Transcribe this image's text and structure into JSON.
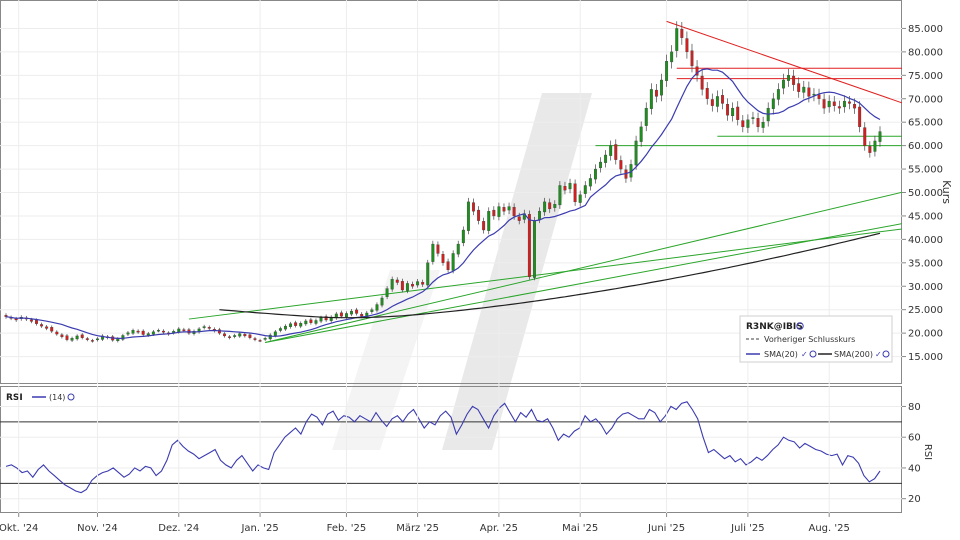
{
  "chart_data": [
    {
      "type": "line",
      "panel": "price",
      "symbol": "R3NK@IBIS",
      "ylabel": "Kurs",
      "ylim": [
        10000,
        90000
      ],
      "yticks": [
        15000,
        20000,
        25000,
        30000,
        35000,
        40000,
        45000,
        50000,
        55000,
        60000,
        65000,
        70000,
        75000,
        80000,
        85000
      ],
      "ytick_labels": [
        "15.000",
        "20.000",
        "25.000",
        "30.000",
        "35.000",
        "40.000",
        "45.000",
        "50.000",
        "55.000",
        "60.000",
        "65.000",
        "70.000",
        "75.000",
        "80.000",
        "85.000"
      ],
      "x_months": [
        "Okt. '24",
        "Nov. '24",
        "Dez. '24",
        "Jan. '25",
        "Feb. '25",
        "März '25",
        "Apr. '25",
        "Mai '25",
        "Juni '25",
        "Juli '25",
        "Aug. '25"
      ],
      "close": [
        23.5,
        23.2,
        22.8,
        23.4,
        23.0,
        22.5,
        22.0,
        21.5,
        21.0,
        20.4,
        19.8,
        19.2,
        18.6,
        18.9,
        19.4,
        19.0,
        18.6,
        18.3,
        18.8,
        19.4,
        19.0,
        18.5,
        18.8,
        19.5,
        20.1,
        20.6,
        20.2,
        19.7,
        19.9,
        20.3,
        20.6,
        20.2,
        19.8,
        20.4,
        20.9,
        20.5,
        20.0,
        20.4,
        20.9,
        21.4,
        21.0,
        20.5,
        20.0,
        19.4,
        19.0,
        19.5,
        19.9,
        19.4,
        19.0,
        18.6,
        18.4,
        18.9,
        19.6,
        20.3,
        21.0,
        21.5,
        22.0,
        21.6,
        22.1,
        22.6,
        22.2,
        22.7,
        23.3,
        22.8,
        23.4,
        24.1,
        23.6,
        24.2,
        24.7,
        24.2,
        23.6,
        24.3,
        25.0,
        26.1,
        27.5,
        29.5,
        31.5,
        30.8,
        29.2,
        30.6,
        30.0,
        31.0,
        30.4,
        35.0,
        39.0,
        37.0,
        35.0,
        33.5,
        37.0,
        39.0,
        42.0,
        48.0,
        46.0,
        44.0,
        42.0,
        46.0,
        45.0,
        47.0,
        46.0,
        47.0,
        45.0,
        44.0,
        45.5,
        32.0,
        44.0,
        46.0,
        48.0,
        46.5,
        47.5,
        51.5,
        50.5,
        52.0,
        48.0,
        49.5,
        51.5,
        53.0,
        55.0,
        56.5,
        58.0,
        60.0,
        57.0,
        55.0,
        53.0,
        56.0,
        61.0,
        64.0,
        68.0,
        72.0,
        70.5,
        74.0,
        78.0,
        80.0,
        85.0,
        83.0,
        80.0,
        77.0,
        75.0,
        72.0,
        70.0,
        68.5,
        70.5,
        69.0,
        66.5,
        68.0,
        65.5,
        64.0,
        65.5,
        66.0,
        64.0,
        65.0,
        68.0,
        70.0,
        72.0,
        74.0,
        75.0,
        73.0,
        71.5,
        72.5,
        70.5,
        71.0,
        70.0,
        68.0,
        69.5,
        68.5,
        68.0,
        69.5,
        69.0,
        68.0,
        64.0,
        60.0,
        58.5,
        61.0,
        63.0
      ],
      "series": [
        {
          "name": "SMA(20)",
          "color": "#3b3bb0"
        },
        {
          "name": "SMA(200)",
          "color": "#222222"
        }
      ],
      "legend": {
        "title": "R3NK@IBIS",
        "prev_close_label": "Vorheriger Schlusskurs",
        "sma20_label": "SMA(20)",
        "sma200_label": "SMA(200)",
        "placement": "bottom-right"
      },
      "colors": {
        "up": "#1e8f1e",
        "down": "#d22020",
        "resistance": "#e02020",
        "support": "#2aa52a"
      }
    },
    {
      "type": "line",
      "panel": "rsi",
      "title": "RSI",
      "series_label": "(14)",
      "ylabel": "RSI",
      "ylim": [
        12,
        92
      ],
      "yticks": [
        20,
        40,
        60,
        80
      ],
      "ytick_labels": [
        "20",
        "40",
        "60",
        "80"
      ],
      "thresholds": [
        30,
        70
      ],
      "values": [
        41,
        42,
        40,
        37,
        38,
        34,
        39,
        42,
        38,
        35,
        32,
        29,
        27,
        25,
        24,
        26,
        32,
        35,
        37,
        38,
        40,
        37,
        34,
        36,
        40,
        38,
        41,
        40,
        35,
        38,
        45,
        55,
        58,
        54,
        51,
        49,
        46,
        48,
        50,
        52,
        45,
        42,
        40,
        45,
        48,
        43,
        38,
        42,
        40,
        39,
        50,
        55,
        60,
        63,
        66,
        62,
        70,
        75,
        73,
        68,
        75,
        77,
        71,
        74,
        73,
        70,
        74,
        72,
        70,
        76,
        71,
        67,
        72,
        74,
        70,
        75,
        78,
        72,
        66,
        70,
        68,
        74,
        77,
        73,
        62,
        68,
        75,
        80,
        78,
        72,
        66,
        74,
        79,
        82,
        76,
        70,
        76,
        73,
        78,
        71,
        70,
        72,
        66,
        58,
        62,
        60,
        64,
        66,
        74,
        70,
        72,
        68,
        62,
        66,
        72,
        75,
        76,
        74,
        72,
        72,
        78,
        76,
        70,
        74,
        80,
        78,
        82,
        83,
        78,
        72,
        60,
        50,
        52,
        49,
        46,
        48,
        44,
        46,
        42,
        44,
        47,
        45,
        48,
        52,
        55,
        60,
        58,
        57,
        53,
        56,
        54,
        52,
        51,
        49,
        48,
        49,
        42,
        48,
        47,
        43,
        35,
        31,
        33,
        38
      ]
    }
  ]
}
